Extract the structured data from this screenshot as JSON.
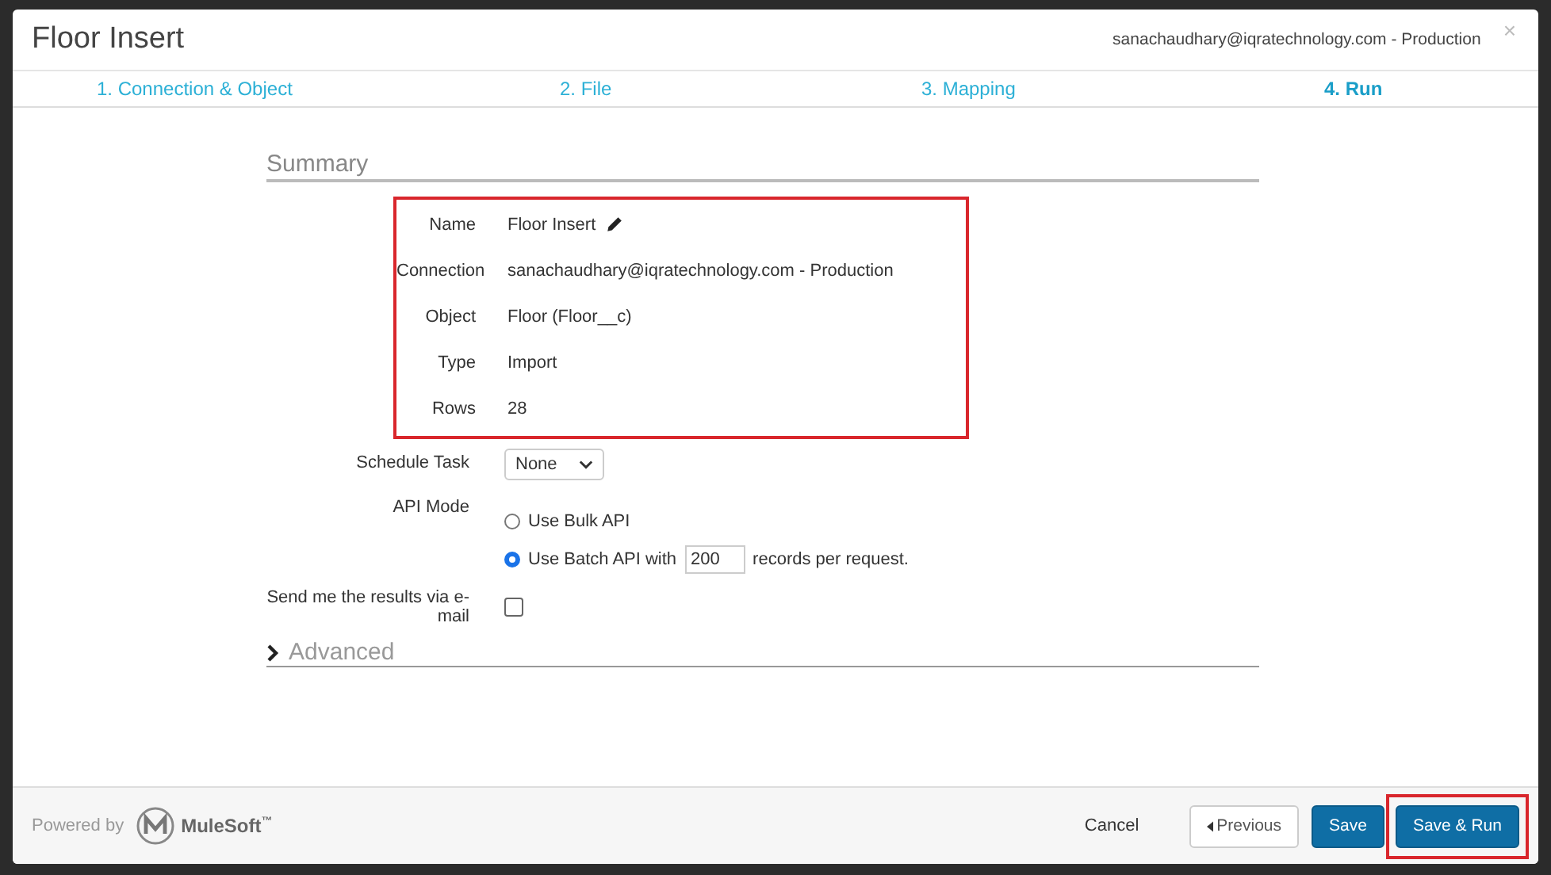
{
  "window": {
    "title": "Floor Insert",
    "account": "sanachaudhary@iqratechnology.com - Production",
    "close": "×"
  },
  "steps": [
    {
      "label": "1. Connection & Object",
      "selected": false
    },
    {
      "label": "2. File",
      "selected": false
    },
    {
      "label": "3. Mapping",
      "selected": false
    },
    {
      "label": "4. Run",
      "selected": true
    }
  ],
  "summary": {
    "title": "Summary",
    "highlighted": true,
    "rows": [
      {
        "label": "Name",
        "value": "Floor Insert",
        "editable": true
      },
      {
        "label": "Connection",
        "value": "sanachaudhary@iqratechnology.com - Production",
        "editable": false
      },
      {
        "label": "Object",
        "value": "Floor (Floor__c)",
        "editable": false
      },
      {
        "label": "Type",
        "value": "Import",
        "editable": false
      },
      {
        "label": "Rows",
        "value": "28",
        "editable": false
      }
    ]
  },
  "schedule": {
    "label": "Schedule Task",
    "value": "None"
  },
  "api_mode": {
    "label": "API Mode",
    "options": [
      {
        "kind": "plain",
        "label": "Use Bulk API",
        "selected": false
      },
      {
        "kind": "batch",
        "label": "Use Batch API with",
        "batch_size": "200",
        "suffix": "records per request.",
        "selected": true
      }
    ]
  },
  "email": {
    "label": "Send me the results via e-mail",
    "checked": false
  },
  "advanced": {
    "label": "Advanced",
    "expanded": false
  },
  "footer": {
    "powered_by": "Powered by",
    "brand": "MuleSoft",
    "trademark": "™",
    "buttons": [
      {
        "kind": "link",
        "label": "Cancel",
        "highlighted": false
      },
      {
        "kind": "back",
        "label": "Previous",
        "highlighted": false
      },
      {
        "kind": "primary",
        "label": "Save",
        "highlighted": false
      },
      {
        "kind": "primary",
        "label": "Save & Run",
        "highlighted": true
      }
    ]
  }
}
